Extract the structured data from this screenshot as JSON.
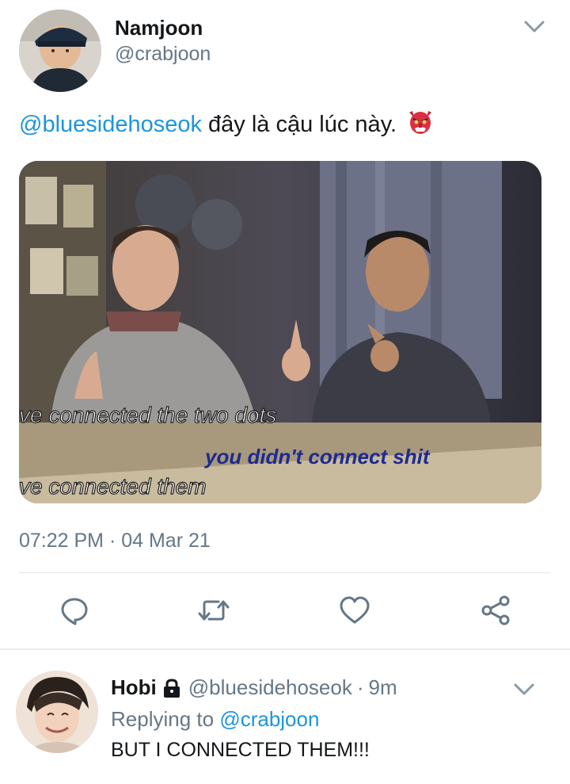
{
  "tweet": {
    "author_name": "Namjoon",
    "author_handle": "@crabjoon",
    "mention": "@bluesidehoseok",
    "text": "đây là cậu lúc này.",
    "emoji": "goblin-mask-emoji",
    "media": {
      "caption_line_1": "ve connected the two dots",
      "caption_line_2": "you didn't connect shit",
      "caption_line_3": "ve connected them"
    },
    "timestamp": "07:22 PM · 04 Mar 21",
    "actions": [
      "reply-icon",
      "retweet-icon",
      "like-icon",
      "share-icon"
    ]
  },
  "reply": {
    "author_name": "Hobi",
    "author_handle": "@bluesidehoseok",
    "separator": "·",
    "time": "9m",
    "replying_prefix": "Replying to",
    "replying_to": "@crabjoon",
    "text": "BUT I CONNECTED THEM!!!"
  },
  "colors": {
    "link": "#1b95e0",
    "secondary_text": "#657786",
    "divider": "#e1e8ed"
  }
}
